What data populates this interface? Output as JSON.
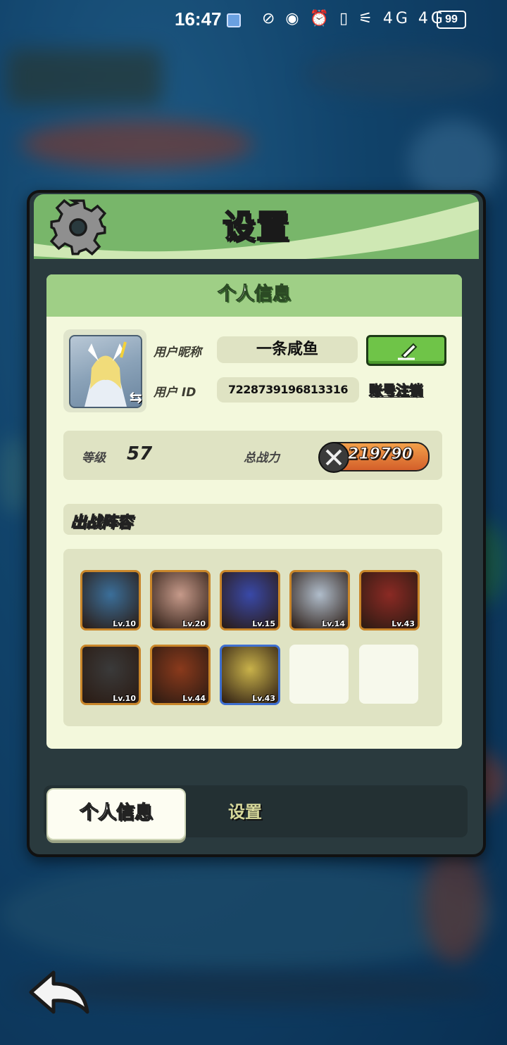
{
  "status_bar": {
    "time": "16:47",
    "icons": "⊘ ◉ ⏰ ▯ ⚟ 4G 4G",
    "battery": "99"
  },
  "dialog": {
    "title": "设置",
    "panel_title": "个人信息",
    "nickname_label": "用户昵称",
    "nickname_value": "一条咸鱼",
    "id_label": "用户 ID",
    "id_value": "7228739196813316",
    "logout_label": "账号注销",
    "level_label": "等级",
    "level_value": "57",
    "power_label": "总战力",
    "power_value": "219790",
    "lineup_title": "出战阵容",
    "heroes": [
      {
        "level": "Lv.10",
        "frame": "gold",
        "color": "#3b6f9a"
      },
      {
        "level": "Lv.20",
        "frame": "gold",
        "color": "#c69a8a"
      },
      {
        "level": "Lv.15",
        "frame": "gold",
        "color": "#3949a8"
      },
      {
        "level": "Lv.14",
        "frame": "gold",
        "color": "#b0bdcb"
      },
      {
        "level": "Lv.43",
        "frame": "gold",
        "color": "#8b2a24"
      },
      {
        "level": "Lv.10",
        "frame": "gold",
        "color": "#3a3a3a"
      },
      {
        "level": "Lv.44",
        "frame": "gold",
        "color": "#8a3a1c"
      },
      {
        "level": "Lv.43",
        "frame": "blue",
        "color": "#c9b24a"
      }
    ],
    "empty_slots": 2,
    "tabs": {
      "active": "个人信息",
      "inactive": "设置"
    }
  },
  "colors": {
    "header_green": "#78b66a",
    "panel_bg": "#f3f8dc",
    "edit_button": "#6fc448"
  }
}
